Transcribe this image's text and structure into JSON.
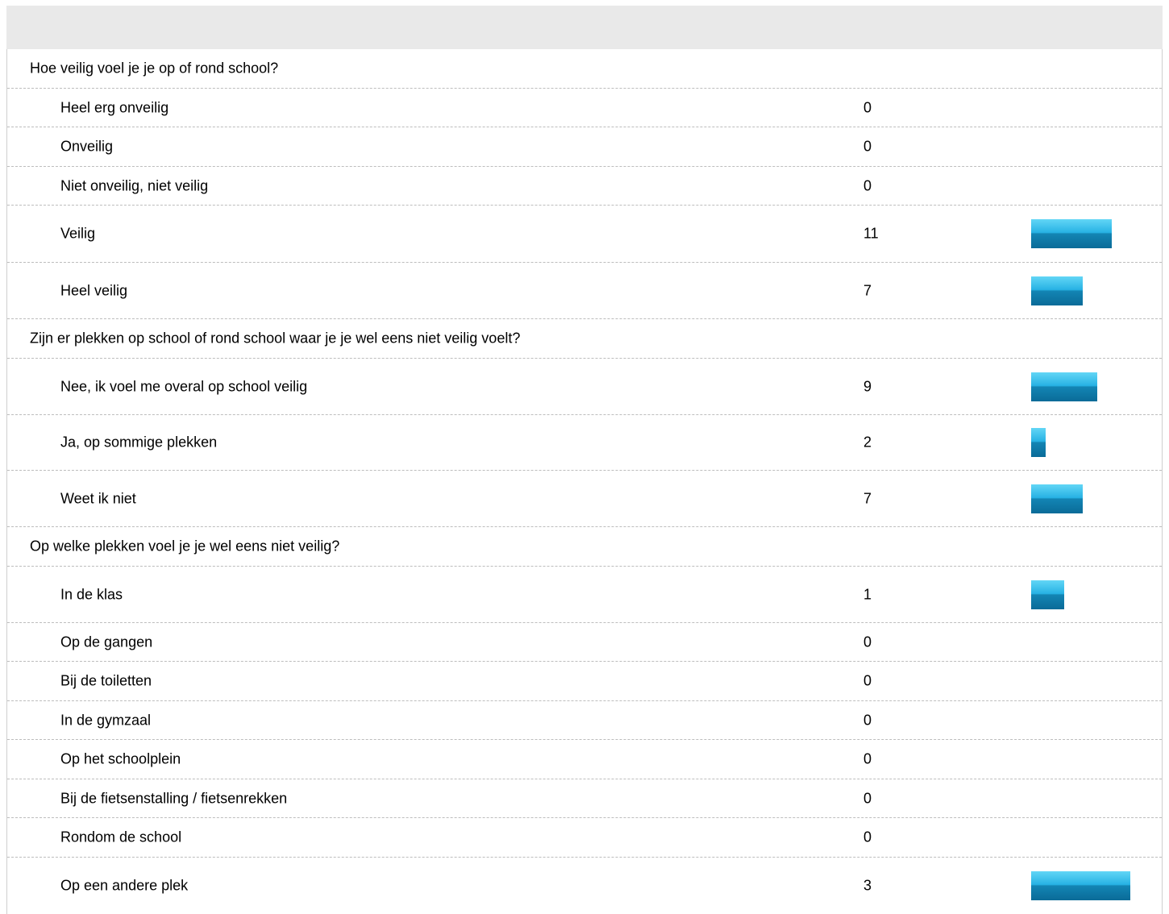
{
  "colors": {
    "header_band": "#e9e9e9",
    "bar_top": "#62d6f6",
    "bar_bottom": "#0a6b98",
    "divider": "#bdbdbd"
  },
  "questions": [
    {
      "title": "Hoe veilig voel je je op of rond school?",
      "answers": [
        {
          "label": "Heel erg onveilig",
          "count": "0",
          "value": 0
        },
        {
          "label": "Onveilig",
          "count": "0",
          "value": 0
        },
        {
          "label": "Niet onveilig, niet veilig",
          "count": "0",
          "value": 0
        },
        {
          "label": "Veilig",
          "count": "11",
          "value": 11
        },
        {
          "label": "Heel veilig",
          "count": "7",
          "value": 7
        }
      ]
    },
    {
      "title": "Zijn er plekken op school of rond school waar je je wel eens niet veilig voelt?",
      "answers": [
        {
          "label": "Nee, ik voel me overal op school veilig",
          "count": "9",
          "value": 9
        },
        {
          "label": "Ja, op sommige plekken",
          "count": "2",
          "value": 2
        },
        {
          "label": "Weet ik niet",
          "count": "7",
          "value": 7
        }
      ]
    },
    {
      "title": "Op welke plekken voel je je wel eens niet veilig?",
      "answers": [
        {
          "label": "In de klas",
          "count": "1",
          "value": 1
        },
        {
          "label": "Op de gangen",
          "count": "0",
          "value": 0
        },
        {
          "label": "Bij de toiletten",
          "count": "0",
          "value": 0
        },
        {
          "label": "In de gymzaal",
          "count": "0",
          "value": 0
        },
        {
          "label": "Op het schoolplein",
          "count": "0",
          "value": 0
        },
        {
          "label": "Bij de fietsenstalling / fietsenrekken",
          "count": "0",
          "value": 0
        },
        {
          "label": "Rondom de school",
          "count": "0",
          "value": 0
        },
        {
          "label": "Op een andere plek",
          "count": "3",
          "value": 3
        }
      ]
    }
  ]
}
